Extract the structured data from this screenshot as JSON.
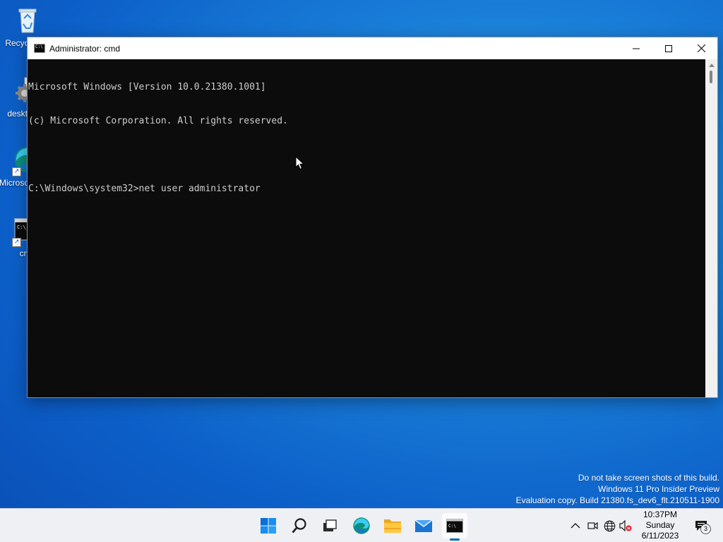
{
  "desktop": {
    "icons": [
      {
        "label": "Recycle Bin",
        "icon": "recycle-bin-icon"
      },
      {
        "label": "desktop.ini",
        "icon": "gear-icon"
      },
      {
        "label": "Microsoft Edge",
        "icon": "edge-icon"
      },
      {
        "label": "cmd",
        "icon": "cmd-icon"
      }
    ]
  },
  "window": {
    "title": "Administrator: cmd",
    "console_lines": [
      "Microsoft Windows [Version 10.0.21380.1001]",
      "(c) Microsoft Corporation. All rights reserved.",
      "",
      "C:\\Windows\\system32>net user administrator"
    ]
  },
  "watermark": {
    "line1": "Do not take screen shots of this build.",
    "line2": "Windows 11 Pro Insider Preview",
    "line3": "Evaluation copy. Build 21380.fs_dev6_flt.210511-1900"
  },
  "taskbar": {
    "apps": [
      {
        "name": "start-button",
        "icon": "windows-logo-icon"
      },
      {
        "name": "search-button",
        "icon": "search-icon"
      },
      {
        "name": "task-view-button",
        "icon": "task-view-icon"
      },
      {
        "name": "edge-taskbar-button",
        "icon": "edge-icon"
      },
      {
        "name": "file-explorer-button",
        "icon": "folder-icon"
      },
      {
        "name": "mail-button",
        "icon": "mail-icon"
      },
      {
        "name": "cmd-taskbar-button",
        "icon": "cmd-icon",
        "active": true
      }
    ],
    "clock": {
      "time": "10:37PM",
      "day": "Sunday",
      "date": "6/11/2023"
    },
    "notification_count": "3"
  },
  "colors": {
    "console_bg": "#0c0c0c",
    "console_text": "#cccccc",
    "accent": "#0067c0"
  }
}
